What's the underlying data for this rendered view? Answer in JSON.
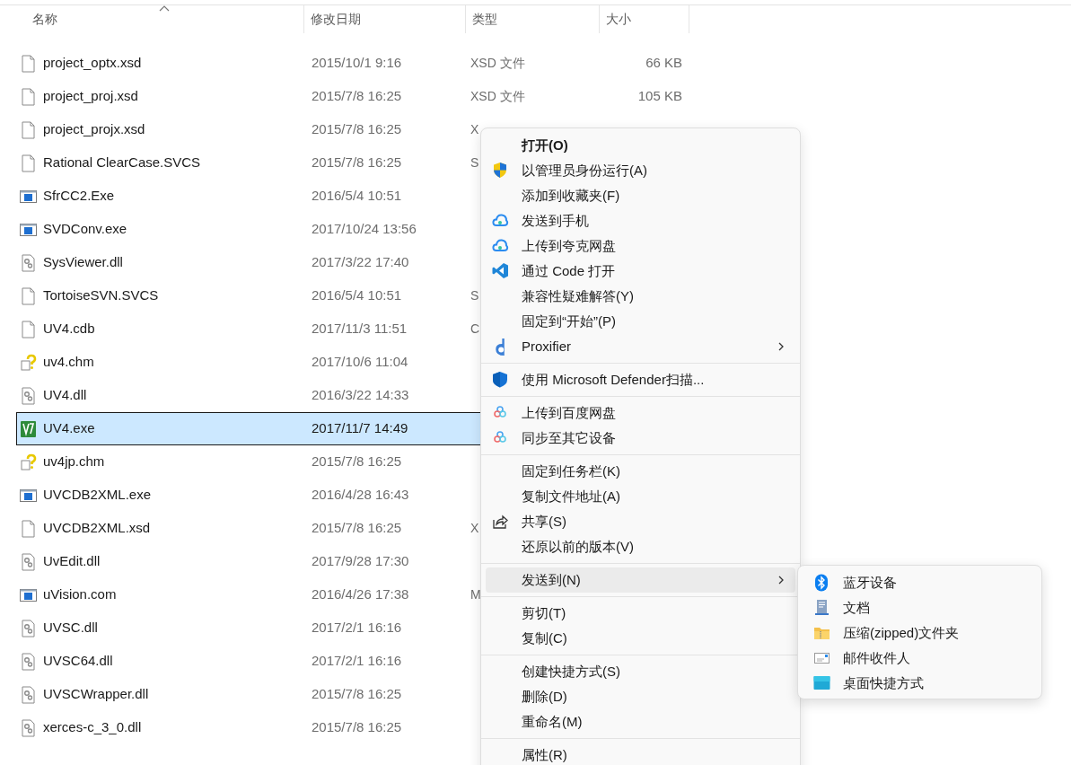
{
  "columns": [
    {
      "label": "名称",
      "sorted": true
    },
    {
      "label": "修改日期",
      "sorted": false
    },
    {
      "label": "类型",
      "sorted": false
    },
    {
      "label": "大小",
      "sorted": false
    }
  ],
  "files": [
    {
      "kind": "blank",
      "name": "project_optx.xsd",
      "date": "2015/10/1 9:16",
      "type": "XSD 文件",
      "size": "66 KB",
      "selected": false
    },
    {
      "kind": "blank",
      "name": "project_proj.xsd",
      "date": "2015/7/8 16:25",
      "type": "XSD 文件",
      "size": "105 KB",
      "selected": false
    },
    {
      "kind": "blank",
      "name": "project_projx.xsd",
      "date": "2015/7/8 16:25",
      "type": "X",
      "selected": false
    },
    {
      "kind": "blank",
      "name": "Rational ClearCase.SVCS",
      "date": "2015/7/8 16:25",
      "type": "S",
      "selected": false
    },
    {
      "kind": "exe",
      "name": "SfrCC2.Exe",
      "date": "2016/5/4 10:51",
      "selected": false
    },
    {
      "kind": "exe",
      "name": "SVDConv.exe",
      "date": "2017/10/24 13:56",
      "selected": false
    },
    {
      "kind": "dll",
      "name": "SysViewer.dll",
      "date": "2017/3/22 17:40",
      "selected": false
    },
    {
      "kind": "blank",
      "name": "TortoiseSVN.SVCS",
      "date": "2016/5/4 10:51",
      "type": "S",
      "selected": false
    },
    {
      "kind": "blank",
      "name": "UV4.cdb",
      "date": "2017/11/3 11:51",
      "type": "C",
      "selected": false
    },
    {
      "kind": "chm",
      "name": "uv4.chm",
      "date": "2017/10/6 11:04",
      "selected": false
    },
    {
      "kind": "dll",
      "name": "UV4.dll",
      "date": "2016/3/22 14:33",
      "selected": false
    },
    {
      "kind": "uv",
      "name": "UV4.exe",
      "date": "2017/11/7 14:49",
      "selected": true
    },
    {
      "kind": "chm",
      "name": "uv4jp.chm",
      "date": "2015/7/8 16:25",
      "selected": false
    },
    {
      "kind": "exe",
      "name": "UVCDB2XML.exe",
      "date": "2016/4/28 16:43",
      "selected": false
    },
    {
      "kind": "blank",
      "name": "UVCDB2XML.xsd",
      "date": "2015/7/8 16:25",
      "type": "X",
      "selected": false
    },
    {
      "kind": "dll",
      "name": "UvEdit.dll",
      "date": "2017/9/28 17:30",
      "selected": false
    },
    {
      "kind": "exe",
      "name": "uVision.com",
      "date": "2016/4/26 17:38",
      "type": "M",
      "selected": false
    },
    {
      "kind": "dll",
      "name": "UVSC.dll",
      "date": "2017/2/1 16:16",
      "selected": false
    },
    {
      "kind": "dll",
      "name": "UVSC64.dll",
      "date": "2017/2/1 16:16",
      "selected": false
    },
    {
      "kind": "dll",
      "name": "UVSCWrapper.dll",
      "date": "2015/7/8 16:25",
      "selected": false
    },
    {
      "kind": "dll",
      "name": "xerces-c_3_0.dll",
      "date": "2015/7/8 16:25",
      "selected": false
    }
  ],
  "context_menu": {
    "items": [
      {
        "kind": "default",
        "label": "打开(O)",
        "has_submenu": false,
        "selected": false
      },
      {
        "kind": "shield",
        "label": "以管理员身份运行(A)",
        "has_submenu": false,
        "selected": false
      },
      {
        "kind": "plain",
        "label": "添加到收藏夹(F)",
        "has_submenu": false,
        "selected": false
      },
      {
        "kind": "cloud",
        "label": "发送到手机",
        "has_submenu": false,
        "selected": false
      },
      {
        "kind": "cloud",
        "label": "上传到夸克网盘",
        "has_submenu": false,
        "selected": false
      },
      {
        "kind": "vscode",
        "label": "通过 Code 打开",
        "has_submenu": false,
        "selected": false
      },
      {
        "kind": "plain",
        "label": "兼容性疑难解答(Y)",
        "has_submenu": false,
        "selected": false
      },
      {
        "kind": "plain",
        "label": "固定到“开始”(P)",
        "has_submenu": false,
        "selected": false
      },
      {
        "kind": "proxifier",
        "label": "Proxifier",
        "has_submenu": true,
        "selected": false
      },
      {
        "kind": "separator"
      },
      {
        "kind": "defender",
        "label": "使用 Microsoft Defender扫描...",
        "has_submenu": false,
        "selected": false
      },
      {
        "kind": "separator"
      },
      {
        "kind": "baidu",
        "label": "上传到百度网盘",
        "has_submenu": false,
        "selected": false
      },
      {
        "kind": "baidu",
        "label": "同步至其它设备",
        "has_submenu": false,
        "selected": false
      },
      {
        "kind": "separator"
      },
      {
        "kind": "plain",
        "label": "固定到任务栏(K)",
        "has_submenu": false,
        "selected": false
      },
      {
        "kind": "plain",
        "label": "复制文件地址(A)",
        "has_submenu": false,
        "selected": false
      },
      {
        "kind": "share",
        "label": "共享(S)",
        "has_submenu": false,
        "selected": false
      },
      {
        "kind": "plain",
        "label": "还原以前的版本(V)",
        "has_submenu": false,
        "selected": false
      },
      {
        "kind": "separator"
      },
      {
        "kind": "plain",
        "label": "发送到(N)",
        "has_submenu": true,
        "selected": true
      },
      {
        "kind": "separator"
      },
      {
        "kind": "plain",
        "label": "剪切(T)",
        "has_submenu": false,
        "selected": false
      },
      {
        "kind": "plain",
        "label": "复制(C)",
        "has_submenu": false,
        "selected": false
      },
      {
        "kind": "separator"
      },
      {
        "kind": "plain",
        "label": "创建快捷方式(S)",
        "has_submenu": false,
        "selected": false
      },
      {
        "kind": "plain",
        "label": "删除(D)",
        "has_submenu": false,
        "selected": false
      },
      {
        "kind": "plain",
        "label": "重命名(M)",
        "has_submenu": false,
        "selected": false
      },
      {
        "kind": "separator"
      },
      {
        "kind": "plain",
        "label": "属性(R)",
        "has_submenu": false,
        "selected": false
      }
    ]
  },
  "send_to_menu": {
    "items": [
      {
        "kind": "bluetooth",
        "label": "蓝牙设备"
      },
      {
        "kind": "document",
        "label": "文档"
      },
      {
        "kind": "zip",
        "label": "压缩(zipped)文件夹"
      },
      {
        "kind": "mail",
        "label": "邮件收件人"
      },
      {
        "kind": "desktop",
        "label": "桌面快捷方式"
      }
    ]
  }
}
